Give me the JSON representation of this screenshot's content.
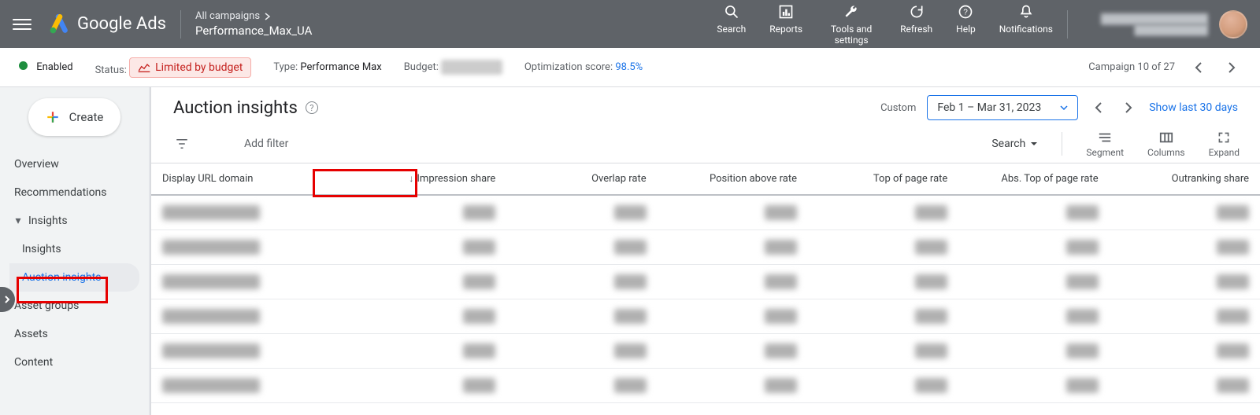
{
  "app": {
    "product_name": "Google Ads"
  },
  "breadcrumb": {
    "line1": "All campaigns",
    "line2": "Performance_Max_UA"
  },
  "header_actions": {
    "search": "Search",
    "reports": "Reports",
    "tools": "Tools and settings",
    "refresh": "Refresh",
    "help": "Help",
    "notifications": "Notifications"
  },
  "info_bar": {
    "enabled": "Enabled",
    "status_label": "Status:",
    "status_value": "Limited by budget",
    "type_label": "Type:",
    "type_value": "Performance Max",
    "budget_label": "Budget:",
    "opt_label": "Optimization score:",
    "opt_value": "98.5%",
    "pager": "Campaign 10 of 27"
  },
  "sidebar": {
    "create": "Create",
    "items": [
      "Overview",
      "Recommendations",
      "Insights",
      "Insights",
      "Auction insights",
      "Asset groups",
      "Assets",
      "Content"
    ]
  },
  "page": {
    "title": "Auction insights",
    "custom_label": "Custom",
    "date_range": "Feb 1 – Mar 31, 2023",
    "show_last": "Show last 30 days"
  },
  "toolbar": {
    "add_filter": "Add filter",
    "search": "Search",
    "segment": "Segment",
    "columns": "Columns",
    "expand": "Expand"
  },
  "table": {
    "headers": {
      "domain": "Display URL domain",
      "imp": "Impression share",
      "overlap": "Overlap rate",
      "position": "Position above rate",
      "top": "Top of page rate",
      "abs_top": "Abs. Top of page rate",
      "outrank": "Outranking share"
    }
  }
}
